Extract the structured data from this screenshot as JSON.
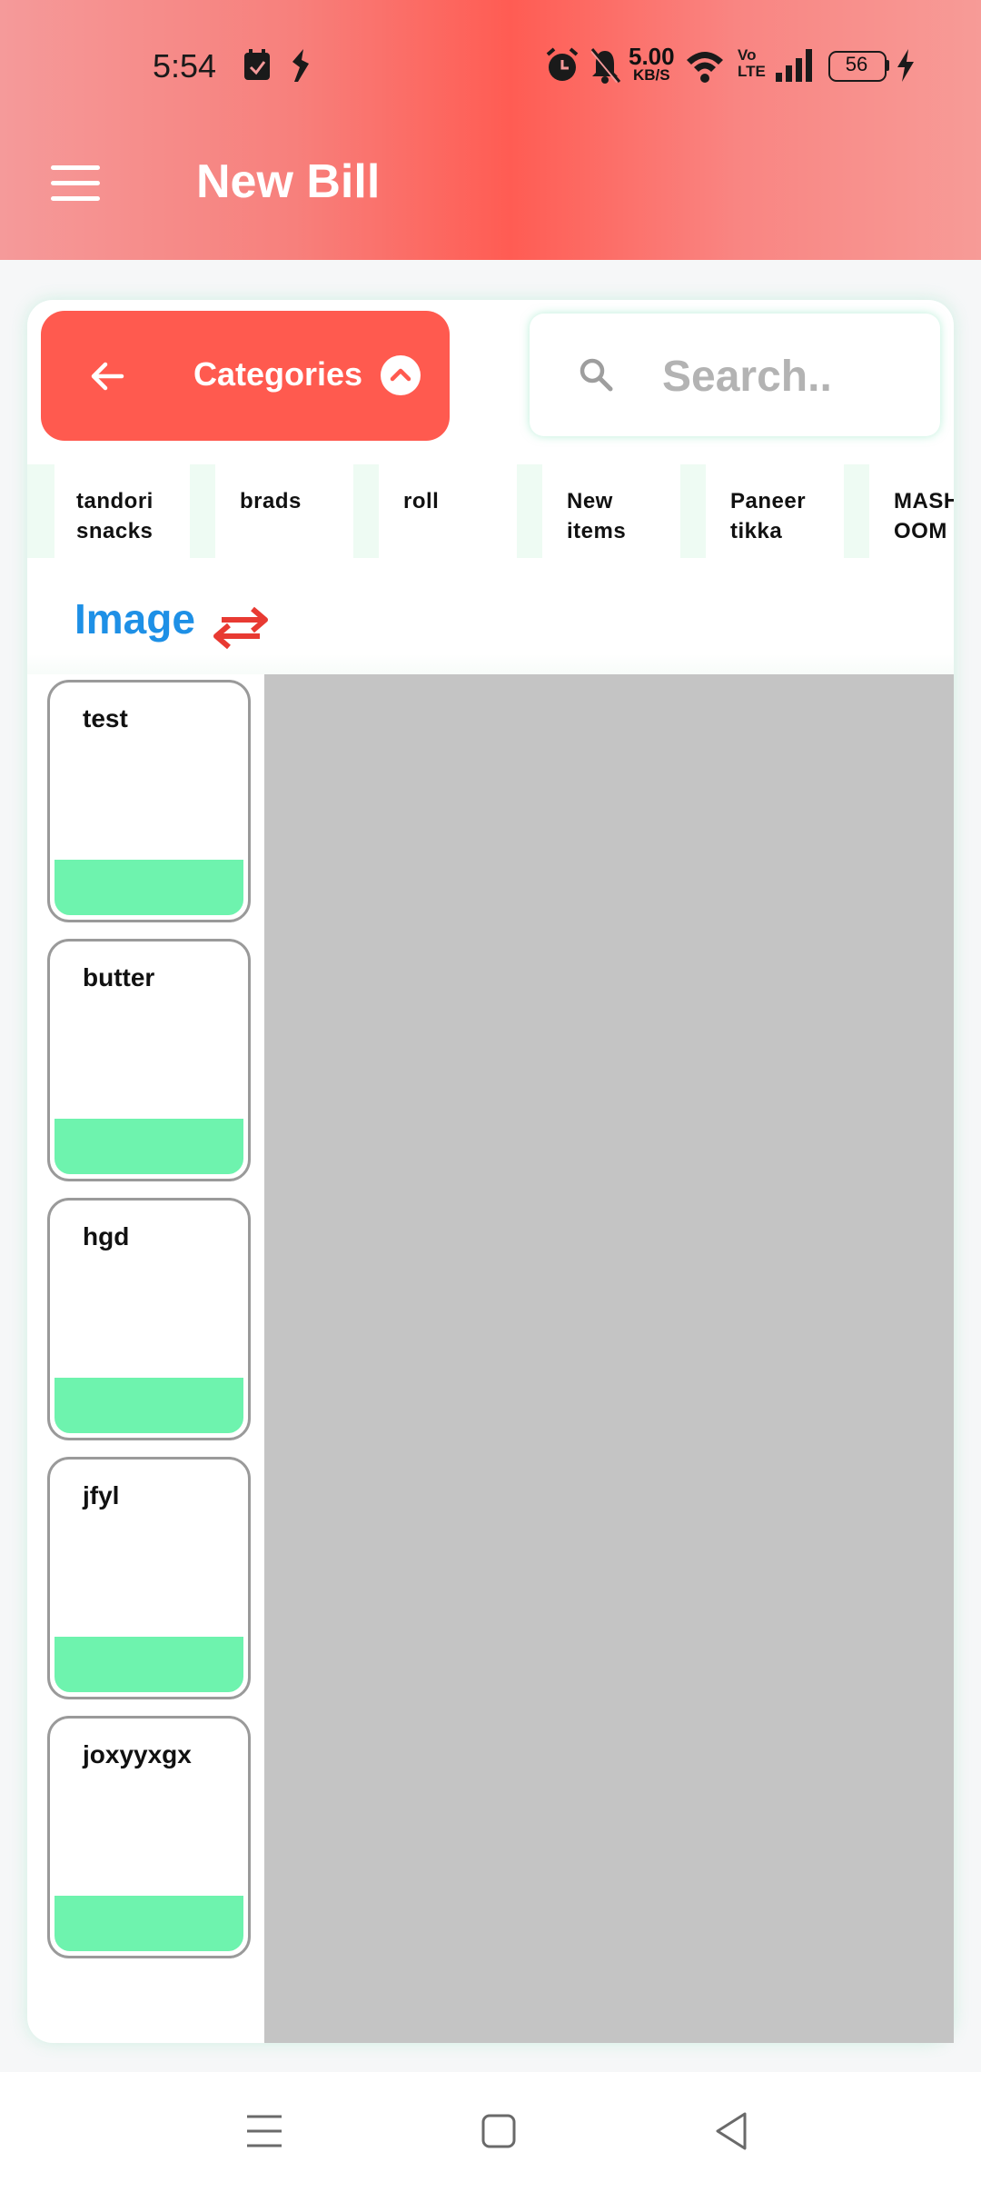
{
  "status_bar": {
    "time": "5:54",
    "net_speed_value": "5.00",
    "net_speed_unit": "KB/S",
    "volte": "Vo\nLTE",
    "battery": "56",
    "icons": [
      "calendar-app-icon",
      "app-notification-icon",
      "alarm-icon",
      "mute-icon",
      "wifi-icon",
      "volte-icon",
      "signal-icon",
      "battery-icon",
      "charging-icon"
    ]
  },
  "app_bar": {
    "title": "New Bill",
    "menu_icon": "hamburger-menu-icon"
  },
  "toolbar": {
    "categories_label": "Categories",
    "back_icon": "arrow-left-icon",
    "expand_icon": "chevron-up-icon",
    "search_placeholder": "Search..",
    "search_icon": "search-icon"
  },
  "categories": [
    {
      "label": "tandori\nsnacks"
    },
    {
      "label": "brads"
    },
    {
      "label": "roll"
    },
    {
      "label": "New\nitems"
    },
    {
      "label": "Paneer\ntikka"
    },
    {
      "label": "MASH\nOOM"
    }
  ],
  "view_toggle": {
    "label": "Image",
    "icon": "swap-arrows-icon"
  },
  "items": [
    {
      "name": "test"
    },
    {
      "name": "butter"
    },
    {
      "name": "hgd"
    },
    {
      "name": "jfyl"
    },
    {
      "name": "joxyyxgx"
    }
  ],
  "nav_bar": {
    "icons": [
      "recents-icon",
      "home-icon",
      "back-icon"
    ]
  },
  "colors": {
    "header_accent": "#ff5c53",
    "categories_button": "#ff5a4f",
    "view_label": "#1e90e6",
    "swap_icon": "#e83a32",
    "item_bar": "#6ef3ae",
    "preview_bg": "#c4c4c4"
  }
}
